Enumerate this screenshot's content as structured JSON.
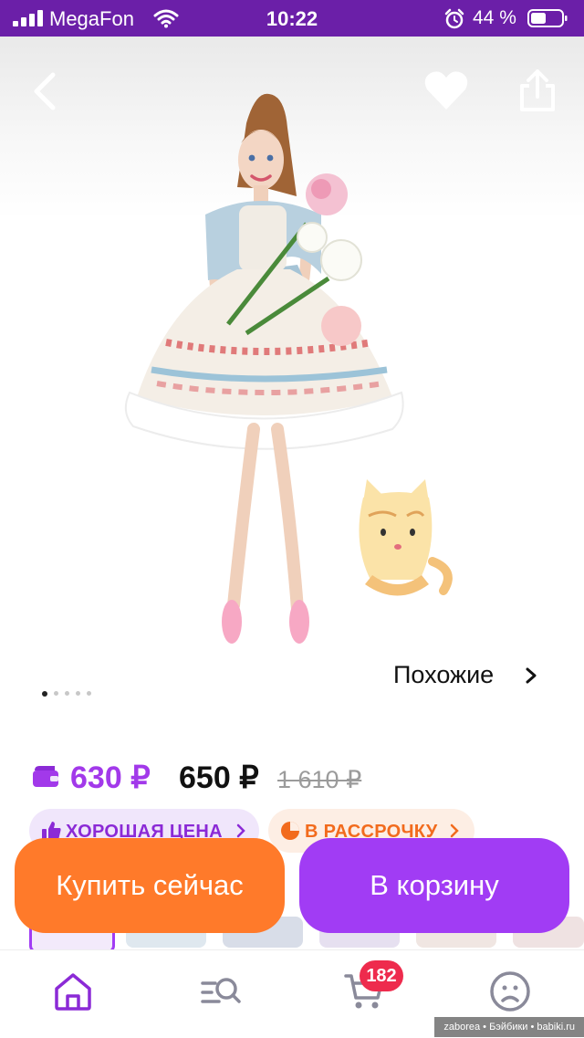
{
  "status": {
    "carrier": "MegaFon",
    "time": "10:22",
    "battery": "44 %"
  },
  "product": {
    "similar_label": "Похожие",
    "gallery": {
      "total": 5,
      "active": 1
    },
    "price_wallet": "630 ₽",
    "price_now": "650 ₽",
    "price_old": "1 610 ₽",
    "badges": [
      {
        "label": "ХОРОШАЯ ЦЕНА"
      },
      {
        "label": "В РАССРОЧКУ"
      }
    ]
  },
  "actions": {
    "buy_now": "Купить сейчас",
    "add_to_cart": "В корзину"
  },
  "tabbar": {
    "cart_count": "182"
  },
  "watermark": "zaborea • Бэйбики • babiki.ru",
  "colors": {
    "status_bar": "#6b1fa8",
    "accent_purple": "#a13cf4",
    "accent_orange": "#ff7a2a",
    "badge_red": "#ee2b4d"
  },
  "icons": [
    "back-icon",
    "heart-icon",
    "share-icon",
    "chevron-right-icon",
    "wallet-icon",
    "thumbs-up-icon",
    "pie-chart-icon",
    "home-icon",
    "catalog-search-icon",
    "cart-icon",
    "profile-icon"
  ]
}
